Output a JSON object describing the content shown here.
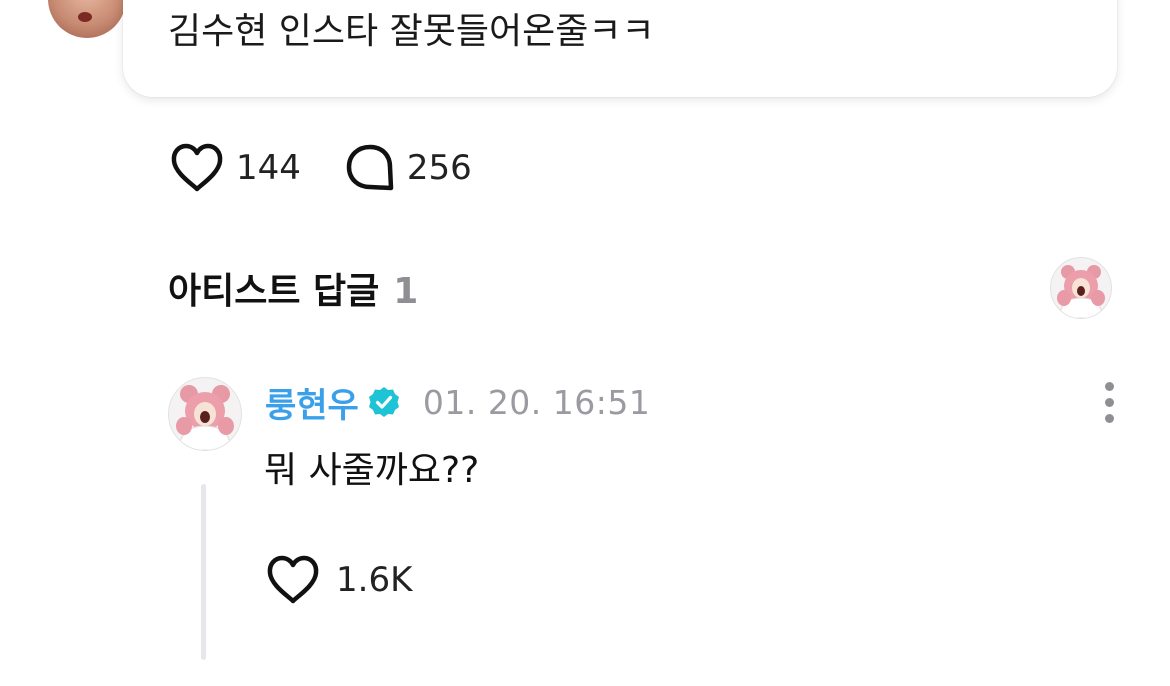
{
  "post": {
    "text": "김수현 인스타 잘못들어온줄ㅋㅋ",
    "likes": "144",
    "comments": "256"
  },
  "artist_replies": {
    "title": "아티스트 답글",
    "count": "1"
  },
  "reply": {
    "author": "룽현우",
    "timestamp": "01. 20. 16:51",
    "text": "뭐 사줄까요??",
    "likes": "1.6K"
  },
  "colors": {
    "author": "#3aa0ea",
    "verified_badge": "#1fc3d6",
    "muted": "#8e8e93",
    "thread_line": "#e6e6ec"
  },
  "icons": {
    "like": "heart-outline-icon",
    "comment": "speech-bubble-outline-icon",
    "verified": "verified-check-badge-icon",
    "more": "vertical-ellipsis-icon"
  }
}
